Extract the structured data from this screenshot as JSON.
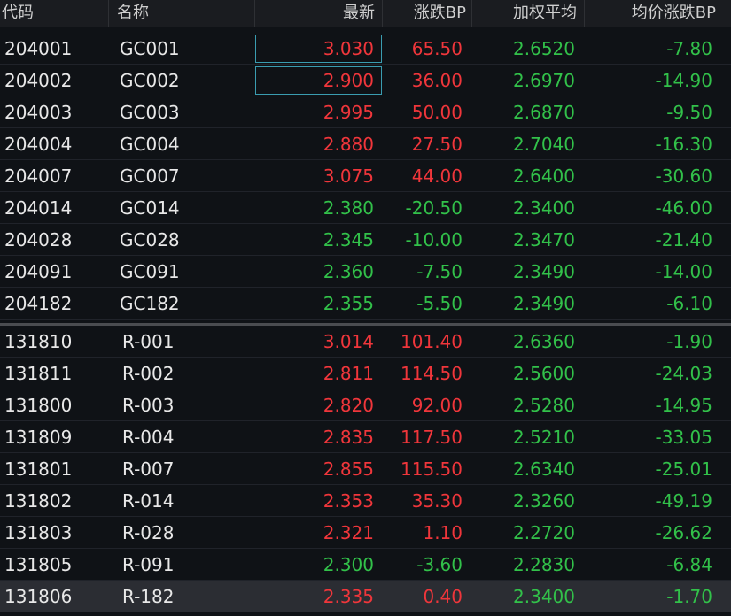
{
  "header": {
    "code": "代码",
    "name": "名称",
    "last": "最新",
    "change_bp": "涨跌BP",
    "weighted_avg": "加权平均",
    "avg_change_bp": "均价涨跌BP"
  },
  "colors": {
    "up": "#f0363b",
    "down": "#32c14a",
    "selection_border": "#3a9cb0"
  },
  "group1": [
    {
      "code": "204001",
      "name": "GC001",
      "last": "3.030",
      "chg": "65.50",
      "avg": "2.6520",
      "achg": "-7.80",
      "dir": "up"
    },
    {
      "code": "204002",
      "name": "GC002",
      "last": "2.900",
      "chg": "36.00",
      "avg": "2.6970",
      "achg": "-14.90",
      "dir": "up"
    },
    {
      "code": "204003",
      "name": "GC003",
      "last": "2.995",
      "chg": "50.00",
      "avg": "2.6870",
      "achg": "-9.50",
      "dir": "up"
    },
    {
      "code": "204004",
      "name": "GC004",
      "last": "2.880",
      "chg": "27.50",
      "avg": "2.7040",
      "achg": "-16.30",
      "dir": "up"
    },
    {
      "code": "204007",
      "name": "GC007",
      "last": "3.075",
      "chg": "44.00",
      "avg": "2.6400",
      "achg": "-30.60",
      "dir": "up"
    },
    {
      "code": "204014",
      "name": "GC014",
      "last": "2.380",
      "chg": "-20.50",
      "avg": "2.3400",
      "achg": "-46.00",
      "dir": "down"
    },
    {
      "code": "204028",
      "name": "GC028",
      "last": "2.345",
      "chg": "-10.00",
      "avg": "2.3470",
      "achg": "-21.40",
      "dir": "down"
    },
    {
      "code": "204091",
      "name": "GC091",
      "last": "2.360",
      "chg": "-7.50",
      "avg": "2.3490",
      "achg": "-14.00",
      "dir": "down"
    },
    {
      "code": "204182",
      "name": "GC182",
      "last": "2.355",
      "chg": "-5.50",
      "avg": "2.3490",
      "achg": "-6.10",
      "dir": "down"
    }
  ],
  "group2": [
    {
      "code": "131810",
      "name": "R-001",
      "last": "3.014",
      "chg": "101.40",
      "avg": "2.6360",
      "achg": "-1.90",
      "dir": "up"
    },
    {
      "code": "131811",
      "name": "R-002",
      "last": "2.811",
      "chg": "114.50",
      "avg": "2.5600",
      "achg": "-24.03",
      "dir": "up"
    },
    {
      "code": "131800",
      "name": "R-003",
      "last": "2.820",
      "chg": "92.00",
      "avg": "2.5280",
      "achg": "-14.95",
      "dir": "up"
    },
    {
      "code": "131809",
      "name": "R-004",
      "last": "2.835",
      "chg": "117.50",
      "avg": "2.5210",
      "achg": "-33.05",
      "dir": "up"
    },
    {
      "code": "131801",
      "name": "R-007",
      "last": "2.855",
      "chg": "115.50",
      "avg": "2.6340",
      "achg": "-25.01",
      "dir": "up"
    },
    {
      "code": "131802",
      "name": "R-014",
      "last": "2.353",
      "chg": "35.30",
      "avg": "2.3260",
      "achg": "-49.19",
      "dir": "up"
    },
    {
      "code": "131803",
      "name": "R-028",
      "last": "2.321",
      "chg": "1.10",
      "avg": "2.2720",
      "achg": "-26.62",
      "dir": "up"
    },
    {
      "code": "131805",
      "name": "R-091",
      "last": "2.300",
      "chg": "-3.60",
      "avg": "2.2830",
      "achg": "-6.84",
      "dir": "down"
    },
    {
      "code": "131806",
      "name": "R-182",
      "last": "2.335",
      "chg": "0.40",
      "avg": "2.3400",
      "achg": "-1.70",
      "dir": "up"
    }
  ]
}
